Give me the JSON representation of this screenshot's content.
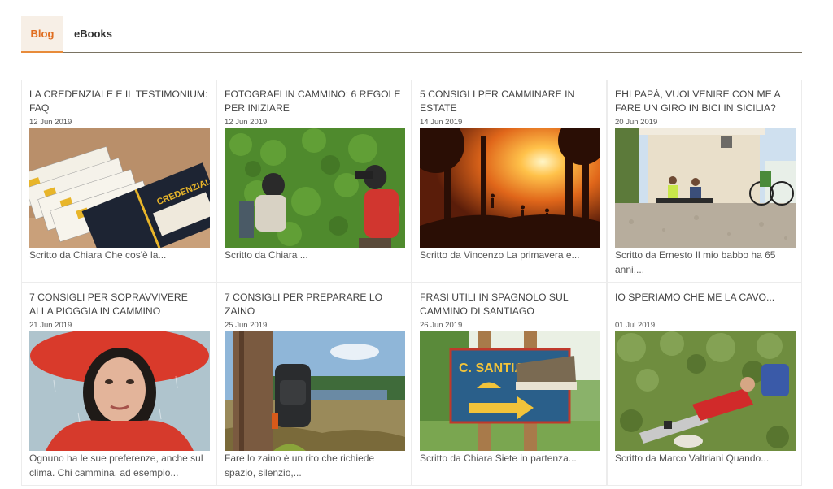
{
  "tabs": {
    "blog": "Blog",
    "ebooks": "eBooks"
  },
  "posts": [
    {
      "title": "LA CREDENZIALE E IL TESTIMONIUM: FAQ",
      "date": "12 Jun 2019",
      "excerpt": "Scritto da Chiara Che cos'è la...",
      "image": "credenziale-booklets-photo",
      "image_text": "CREDENZIALE"
    },
    {
      "title": "FOTOGRAFI IN CAMMINO: 6 REGOLE PER INIZIARE",
      "date": "12 Jun 2019",
      "excerpt": "Scritto da  Chiara  ...",
      "image": "photographers-ivy-wall-photo"
    },
    {
      "title": "5 CONSIGLI PER CAMMINARE IN ESTATE",
      "date": "14 Jun 2019",
      "excerpt": "Scritto da Vincenzo La primavera e...",
      "image": "sunset-forest-walkers-photo"
    },
    {
      "title": "EHI PAPÀ, VUOI VENIRE CON ME A FARE UN GIRO IN BICI IN SICILIA?",
      "date": "20 Jun 2019",
      "excerpt": "Scritto da Ernesto Il mio babbo ha 65 anni,...",
      "image": "cyclists-resting-photo"
    },
    {
      "title": "7 CONSIGLI PER SOPRAVVIVERE ALLA PIOGGIA IN CAMMINO",
      "date": "21 Jun 2019",
      "excerpt": "Ognuno ha le sue preferenze, anche sul clima. Chi cammina, ad esempio...",
      "image": "woman-in-rain-photo"
    },
    {
      "title": "7 CONSIGLI PER PREPARARE LO ZAINO",
      "date": "25 Jun 2019",
      "excerpt": " Fare lo zaino è un rito che richiede spazio, silenzio,...",
      "image": "backpack-by-lake-photo"
    },
    {
      "title": "FRASI UTILI IN SPAGNOLO SUL CAMMINO DI SANTIAGO",
      "date": "26 Jun 2019",
      "excerpt": "Scritto da Chiara   Siete in partenza...",
      "image": "santiago-sign-boot-photo",
      "image_text": "C. SANTIAGO"
    },
    {
      "title": "IO SPERIAMO CHE ME LA CAVO...",
      "date": "01 Jul 2019",
      "excerpt": "Scritto da Marco Valtriani Quando...",
      "image": "hiker-napping-grass-photo"
    }
  ],
  "colors": {
    "accent": "#e06d1f",
    "tab_active_bg": "#f7efe6",
    "divider": "#7a7362"
  }
}
